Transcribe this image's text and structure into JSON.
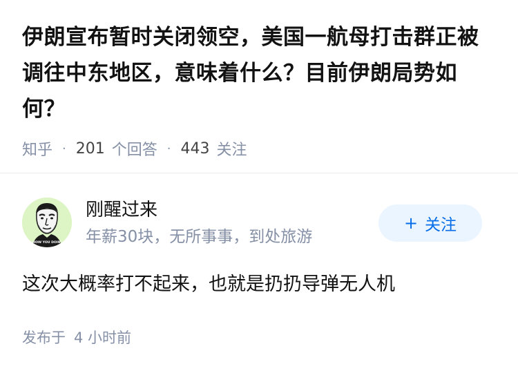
{
  "question": {
    "title": "伊朗宣布暂时关闭领空，美国一航母打击群正被调往中东地区，意味着什么？目前伊朗局势如何？",
    "source": "知乎",
    "answers_count": "201",
    "answers_label": "个回答",
    "followers_count": "443",
    "followers_label": "关注"
  },
  "answer": {
    "author": {
      "name": "刚醒过来",
      "bio": "年薪30块，无所事事，到处旅游",
      "avatar_caption": "HOW YOU DOIN'",
      "avatar_bg": "#ddf5c4"
    },
    "follow_button": {
      "icon": "plus-icon",
      "label": "关注"
    },
    "content": "这次大概率打不起来，也就是扔扔导弹无人机",
    "published_label": "发布于",
    "published_time": "4 小时前"
  },
  "colors": {
    "text": "#121212",
    "muted": "#8590a6",
    "accent": "#056de8",
    "button_bg": "#ebf5ff"
  }
}
